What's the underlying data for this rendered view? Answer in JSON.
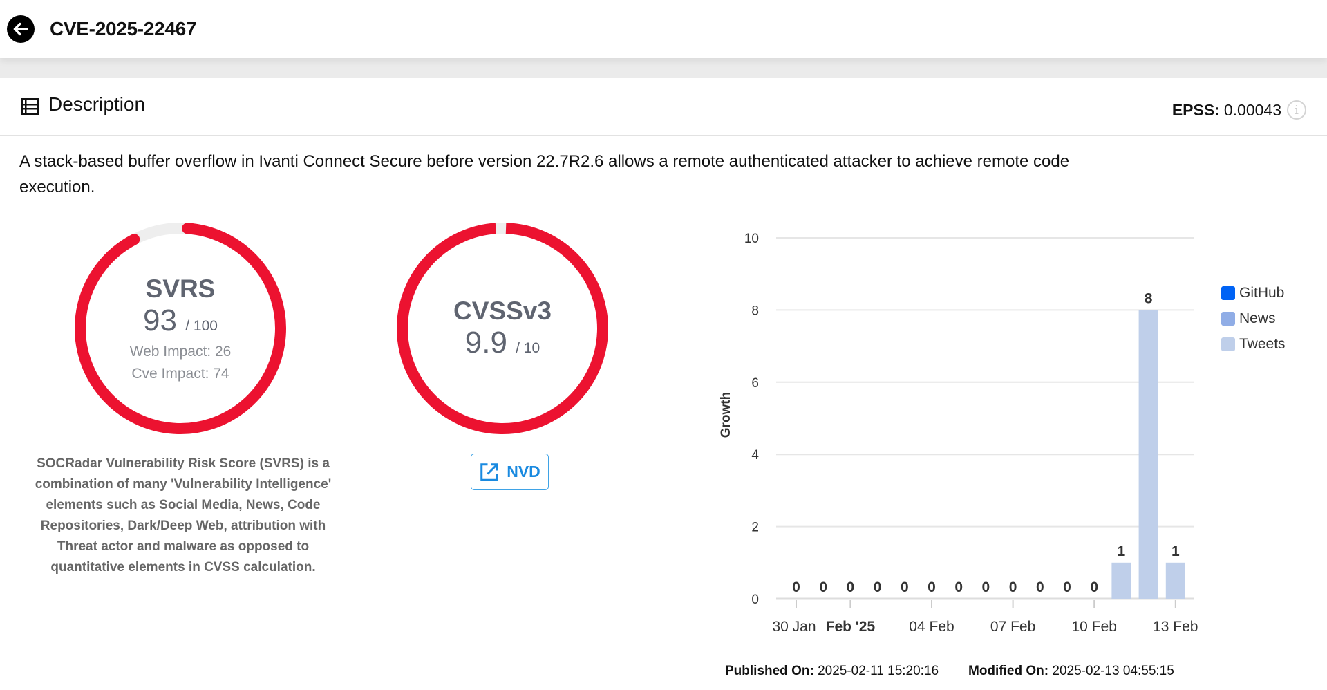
{
  "header": {
    "title": "CVE-2025-22467",
    "back_icon": "arrow-left-circle-icon"
  },
  "section": {
    "title": "Description",
    "icon": "list-icon",
    "epss_label": "EPSS:",
    "epss_value": "0.00043"
  },
  "description": "A stack-based buffer overflow in Ivanti Connect Secure before version 22.7R2.6 allows a remote authenticated attacker to achieve remote code execution.",
  "svrs": {
    "label": "SVRS",
    "score": "93",
    "max": "/ 100",
    "score_value": 93,
    "max_value": 100,
    "web_impact": "Web Impact: 26",
    "cve_impact": "Cve Impact: 74",
    "note": "SOCRadar Vulnerability Risk Score (SVRS) is a combination of many 'Vulnerability Intelligence' elements such as Social Media, News, Code Repositories, Dark/Deep Web, attribution with Threat actor and malware as opposed to quantitative elements in CVSS calculation."
  },
  "cvss": {
    "label": "CVSSv3",
    "score": "9.9",
    "max": "/ 10",
    "score_value": 9.9,
    "max_value": 10,
    "nvd_label": "NVD"
  },
  "colors": {
    "gauge": "#ec1230",
    "gauge_track": "#eeeeee",
    "github": "#0063f5",
    "news": "#90ade6",
    "tweets": "#bfcfea"
  },
  "chart_data": {
    "type": "bar",
    "ylabel": "Growth",
    "ylim": [
      0,
      10
    ],
    "yticks": [
      "0",
      "2",
      "4",
      "6",
      "8",
      "10"
    ],
    "grid": true,
    "legend_placement": "right",
    "categories": [
      "30 Jan",
      "31 Jan",
      "01 Feb",
      "02 Feb",
      "03 Feb",
      "04 Feb",
      "05 Feb",
      "06 Feb",
      "07 Feb",
      "08 Feb",
      "09 Feb",
      "10 Feb",
      "11 Feb",
      "12 Feb",
      "13 Feb"
    ],
    "xtick_labels": [
      {
        "label": "30 Jan",
        "category": "30 Jan",
        "bold": false
      },
      {
        "label": "Feb '25",
        "category": "01 Feb",
        "bold": true
      },
      {
        "label": "04 Feb",
        "category": "04 Feb",
        "bold": false
      },
      {
        "label": "07 Feb",
        "category": "07 Feb",
        "bold": false
      },
      {
        "label": "10 Feb",
        "category": "10 Feb",
        "bold": false
      },
      {
        "label": "13 Feb",
        "category": "13 Feb",
        "bold": false
      }
    ],
    "series": [
      {
        "name": "GitHub",
        "values": [
          0,
          0,
          0,
          0,
          0,
          0,
          0,
          0,
          0,
          0,
          0,
          0,
          0,
          0,
          0
        ]
      },
      {
        "name": "News",
        "values": [
          0,
          0,
          0,
          0,
          0,
          0,
          0,
          0,
          0,
          0,
          0,
          0,
          0,
          0,
          0
        ]
      },
      {
        "name": "Tweets",
        "values": [
          0,
          0,
          0,
          0,
          0,
          0,
          0,
          0,
          0,
          0,
          0,
          0,
          1,
          8,
          1
        ]
      }
    ],
    "totals": [
      0,
      0,
      0,
      0,
      0,
      0,
      0,
      0,
      0,
      0,
      0,
      0,
      1,
      8,
      1
    ]
  },
  "footer": {
    "published_label": "Published On:",
    "published_value": "2025-02-11 15:20:16",
    "modified_label": "Modified On:",
    "modified_value": "2025-02-13 04:55:15"
  }
}
